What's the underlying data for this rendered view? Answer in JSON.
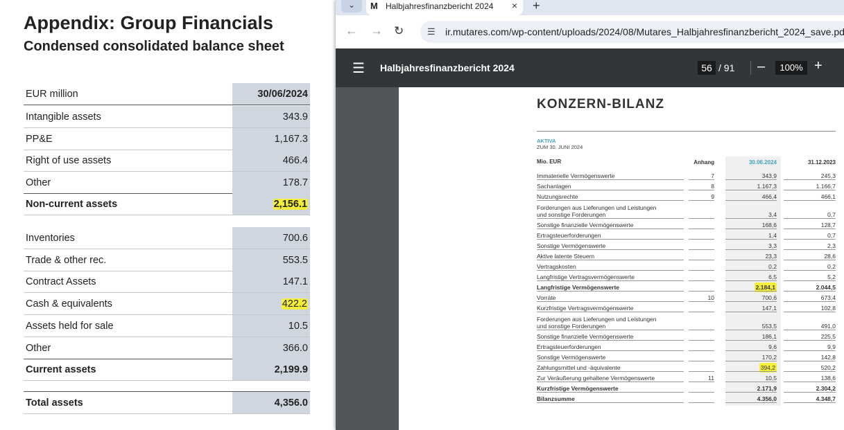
{
  "slide": {
    "title": "Appendix: Group Financials",
    "subtitle": "Condensed consolidated balance sheet",
    "header": {
      "label": "EUR million",
      "column": "30/06/2024"
    },
    "rows": [
      {
        "label": "Intangible assets",
        "value": "343.9"
      },
      {
        "label": "PP&E",
        "value": "1,167.3"
      },
      {
        "label": "Right of use assets",
        "value": "466.4"
      },
      {
        "label": "Other",
        "value": "178.7"
      },
      {
        "label": "Non-current assets",
        "value": "2,156.1",
        "highlighted": true
      },
      {
        "label": "Inventories",
        "value": "700.6"
      },
      {
        "label": "Trade & other rec.",
        "value": "553.5"
      },
      {
        "label": "Contract Assets",
        "value": "147.1"
      },
      {
        "label": "Cash & equivalents",
        "value": "422.2",
        "highlighted": true
      },
      {
        "label": "Assets held for sale",
        "value": "10.5"
      },
      {
        "label": "Other",
        "value": "366.0"
      },
      {
        "label": "Current assets",
        "value": "2,199.9"
      },
      {
        "label": "Total assets",
        "value": "4,356.0"
      }
    ],
    "highlight_color": "#f4f03a"
  },
  "browser": {
    "tab": {
      "favicon": "M",
      "title": "Halbjahresfinanzbericht 2024",
      "close": "×"
    },
    "new_tab": "+",
    "tab_menu": "⌄",
    "url": "ir.mutares.com/wp-content/uploads/2024/08/Mutares_Halbjahresfinanzbericht_2024_save.pdf",
    "viewer": {
      "title": "Halbjahresfinanzbericht 2024",
      "page": "56",
      "total": "/ 91",
      "zoom": "100%"
    }
  },
  "pdf": {
    "title": "KONZERN-BILANZ",
    "section": "AKTIVA",
    "date": "ZUM 30. JUNI 2024",
    "header": {
      "label": "Mio. EUR",
      "anhang": "Anhang",
      "col1": "30.06.2024",
      "col2": "31.12.2023"
    },
    "rows": [
      {
        "label": "Immaterielle Vermögenswerte",
        "anhang": "7",
        "v1": "343,9",
        "v2": "245,3"
      },
      {
        "label": "Sachanlagen",
        "anhang": "8",
        "v1": "1.167,3",
        "v2": "1.166,7"
      },
      {
        "label": "Nutzungsrechte",
        "anhang": "9",
        "v1": "466,4",
        "v2": "466,1"
      },
      {
        "label": "Forderungen aus Lieferungen und Leistungen",
        "label2": "und sonstige Forderungen",
        "anhang": "",
        "v1": "3,4",
        "v2": "0,7"
      },
      {
        "label": "Sonstige finanzielle Vermögenswerte",
        "anhang": "",
        "v1": "168,6",
        "v2": "128,7"
      },
      {
        "label": "Ertragsteuerforderungen",
        "anhang": "",
        "v1": "1,4",
        "v2": "0,7"
      },
      {
        "label": "Sonstige Vermögenswerte",
        "anhang": "",
        "v1": "3,3",
        "v2": "2,3"
      },
      {
        "label": "Aktive latente Steuern",
        "anhang": "",
        "v1": "23,3",
        "v2": "28,6"
      },
      {
        "label": "Vertragskosten",
        "anhang": "",
        "v1": "0,2",
        "v2": "0,2"
      },
      {
        "label": "Langfristige Vertragsvermögenswerte",
        "anhang": "",
        "v1": "6,5",
        "v2": "5,2"
      },
      {
        "label": "Langfristige Vermögenswerte",
        "anhang": "",
        "v1": "2.184,1",
        "v2": "2.044,5",
        "bold": true,
        "highlighted": true
      },
      {
        "label": "Vorräte",
        "anhang": "10",
        "v1": "700,6",
        "v2": "673,4"
      },
      {
        "label": "Kurzfristige Vertragsvermögenswerte",
        "anhang": "",
        "v1": "147,1",
        "v2": "102,8"
      },
      {
        "label": "Forderungen aus Lieferungen und Leistungen",
        "label2": "und sonstige Forderungen",
        "anhang": "",
        "v1": "553,5",
        "v2": "491,0"
      },
      {
        "label": "Sonstige finanzielle Vermögenswerte",
        "anhang": "",
        "v1": "186,1",
        "v2": "225,5"
      },
      {
        "label": "Ertragsteuerforderungen",
        "anhang": "",
        "v1": "9,6",
        "v2": "9,9"
      },
      {
        "label": "Sonstige Vermögenswerte",
        "anhang": "",
        "v1": "170,2",
        "v2": "142,8"
      },
      {
        "label": "Zahlungsmittel und -äquivalente",
        "anhang": "",
        "v1": "394,2",
        "v2": "520,2",
        "highlighted": true
      },
      {
        "label": "Zur Veräußerung gehaltene Vermögenswerte",
        "anhang": "11",
        "v1": "10,5",
        "v2": "138,6"
      },
      {
        "label": "Kurzfristige Vermögenswerte",
        "anhang": "",
        "v1": "2.171,9",
        "v2": "2.304,2",
        "bold": true
      },
      {
        "label": "Bilanzsumme",
        "anhang": "",
        "v1": "4.356,0",
        "v2": "4.348,7",
        "bold": true
      }
    ],
    "accent_color": "#3fa3bd"
  }
}
